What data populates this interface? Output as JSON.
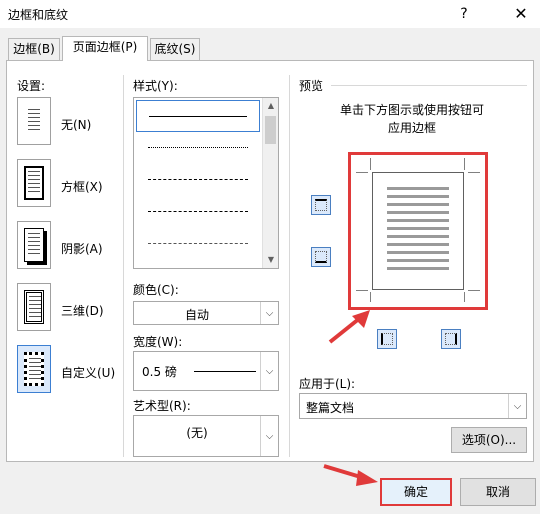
{
  "window": {
    "title": "边框和底纹",
    "help_label": "?",
    "close_label": "✕"
  },
  "tabs": [
    {
      "label": "边框(B)"
    },
    {
      "label": "页面边框(P)"
    },
    {
      "label": "底纹(S)"
    }
  ],
  "settings": {
    "label": "设置:",
    "items": [
      {
        "label": "无(N)",
        "icon": "none-border-icon"
      },
      {
        "label": "方框(X)",
        "icon": "box-border-icon"
      },
      {
        "label": "阴影(A)",
        "icon": "shadow-border-icon"
      },
      {
        "label": "三维(D)",
        "icon": "3d-border-icon"
      },
      {
        "label": "自定义(U)",
        "icon": "custom-border-icon",
        "selected": true
      }
    ]
  },
  "style": {
    "label": "样式(Y):"
  },
  "color": {
    "label": "颜色(C):",
    "value": "自动"
  },
  "width": {
    "label": "宽度(W):",
    "value": "0.5 磅"
  },
  "art": {
    "label": "艺术型(R):",
    "value": "(无)"
  },
  "preview": {
    "label": "预览",
    "hint_line1": "单击下方图示或使用按钮可",
    "hint_line2": "应用边框"
  },
  "apply_to": {
    "label": "应用于(L):",
    "value": "整篇文档"
  },
  "buttons": {
    "options": "选项(O)...",
    "ok": "确定",
    "cancel": "取消"
  },
  "colors": {
    "highlight": "#e03a3a",
    "selected_bg": "#dbe9fb",
    "selected_border": "#3c7fd2"
  }
}
